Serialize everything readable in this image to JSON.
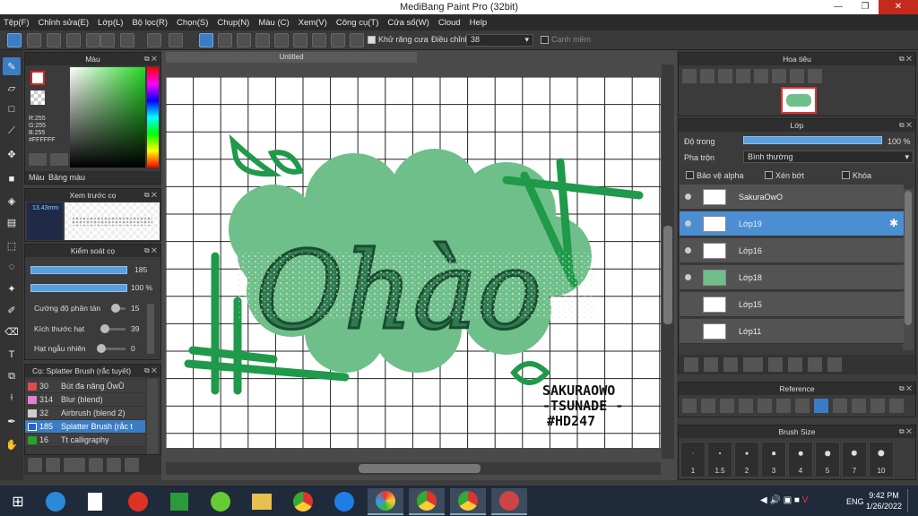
{
  "app": {
    "title": "MediBang Paint Pro (32bit)"
  },
  "menu": [
    "Tệp(F)",
    "Chỉnh sửa(E)",
    "Lớp(L)",
    "Bộ lọc(R)",
    "Chọn(S)",
    "Chụp(N)",
    "Màu (C)",
    "Xem(V)",
    "Công cụ(T)",
    "Cửa sổ(W)",
    "Cloud",
    "Help"
  ],
  "toolbar": {
    "antialias_label": "Khử răng cưa",
    "adjust_label": "Điều chỉnh",
    "adjust_value": "38",
    "snap_label": "Cạnh mềm"
  },
  "color_panel": {
    "title": "Màu",
    "r": "R:255",
    "g": "G:255",
    "b": "B:255",
    "hex": "#FFFFFF",
    "tab_color": "Màu",
    "tab_palette": "Bảng màu"
  },
  "brush_preview": {
    "title": "Xem trước cọ",
    "size": "13.43mm"
  },
  "brush_control": {
    "title": "Kiểm soát cọ",
    "size_value": "185",
    "opacity_value": "100 %",
    "sliders": [
      {
        "label": "Cường độ phân tán",
        "value": "15",
        "fill": 0.15
      },
      {
        "label": "Kích thước hạt",
        "value": "39",
        "fill": 0.39
      },
      {
        "label": "Hạt ngẫu nhiên",
        "value": "0",
        "fill": 0.0
      }
    ]
  },
  "brush_list": {
    "title": "Cọ: Splatter Brush (rắc tuyết)",
    "items": [
      {
        "num": "30",
        "name": "Bút đa năng ŮwŮ",
        "color": "#e04a4a"
      },
      {
        "num": "314",
        "name": "Blur (blend)",
        "color": "#e080d0"
      },
      {
        "num": "32",
        "name": "Airbrush (blend 2)",
        "color": "#cccccc"
      },
      {
        "num": "185",
        "name": "Splatter Brush (rắc t",
        "color": "#2c5fd6",
        "selected": true
      },
      {
        "num": "16",
        "name": "Tt calligraphy",
        "color": "#2aa02a"
      }
    ]
  },
  "document": {
    "tab_title": "Untitled"
  },
  "artwork": {
    "main_text": "Ohào",
    "watermark": [
      "SAKURAOWO",
      "-TSUNADE -",
      "#HD247"
    ]
  },
  "navigator": {
    "title": "Hoa tiêu"
  },
  "layer_panel": {
    "title": "Lớp",
    "opacity_label": "Độ trong",
    "opacity_value": "100 %",
    "opacity_fill": 1.0,
    "blend_label": "Pha trộn",
    "blend_value": "Bình thường",
    "protect_alpha": "Bảo vệ alpha",
    "clipping": "Xén bớt",
    "lock": "Khóa",
    "layers": [
      {
        "name": "SakuraOwO",
        "selected": false
      },
      {
        "name": "Lớp19",
        "selected": true
      },
      {
        "name": "Lớp16",
        "selected": false
      },
      {
        "name": "Lớp18",
        "selected": false
      },
      {
        "name": "Lớp15",
        "selected": false
      },
      {
        "name": "Lớp11",
        "selected": false
      }
    ]
  },
  "reference_panel": {
    "title": "Reference"
  },
  "brush_size_panel": {
    "title": "Brush Size",
    "sizes": [
      "1",
      "1.5",
      "2",
      "3",
      "4",
      "5",
      "7",
      "10"
    ]
  },
  "taskbar": {
    "lang": "ENG",
    "time": "9:42 PM",
    "date": "1/26/2022"
  },
  "colors": {
    "accent": "#3b7dc4",
    "green": "#1f9a4a",
    "cloud": "#6fbf8a"
  }
}
